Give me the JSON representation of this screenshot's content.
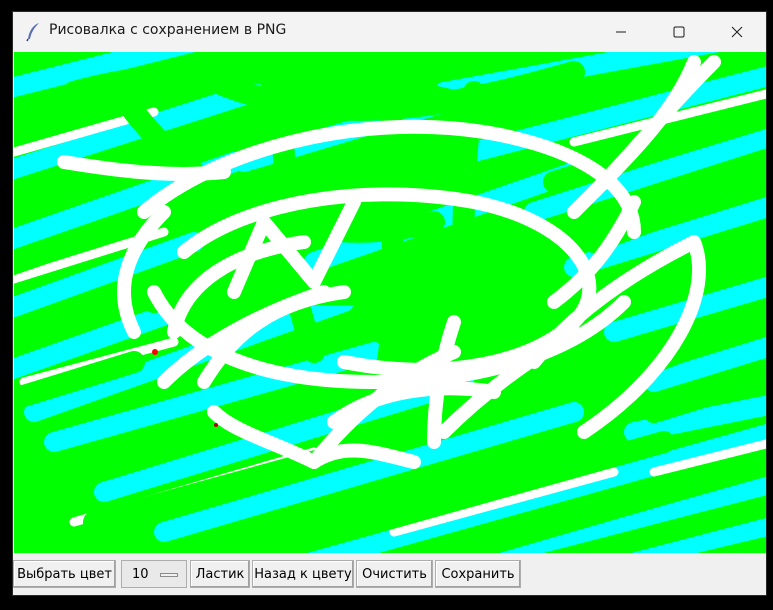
{
  "window": {
    "title": "Рисовалка с сохранением в PNG",
    "app_icon": "feather-icon",
    "controls": {
      "minimize": "minimize-icon",
      "maximize": "maximize-icon",
      "close": "close-icon"
    }
  },
  "canvas": {
    "background_color": "#00ff00",
    "stroke_colors": [
      "#00ffff",
      "#ffffff",
      "#00ff00",
      "#ff0000"
    ]
  },
  "toolbar": {
    "choose_color_label": "Выбрать цвет",
    "brush_size_value": "10",
    "eraser_label": "Ластик",
    "back_to_color_label": "Назад к цвету",
    "clear_label": "Очистить",
    "save_label": "Сохранить"
  }
}
